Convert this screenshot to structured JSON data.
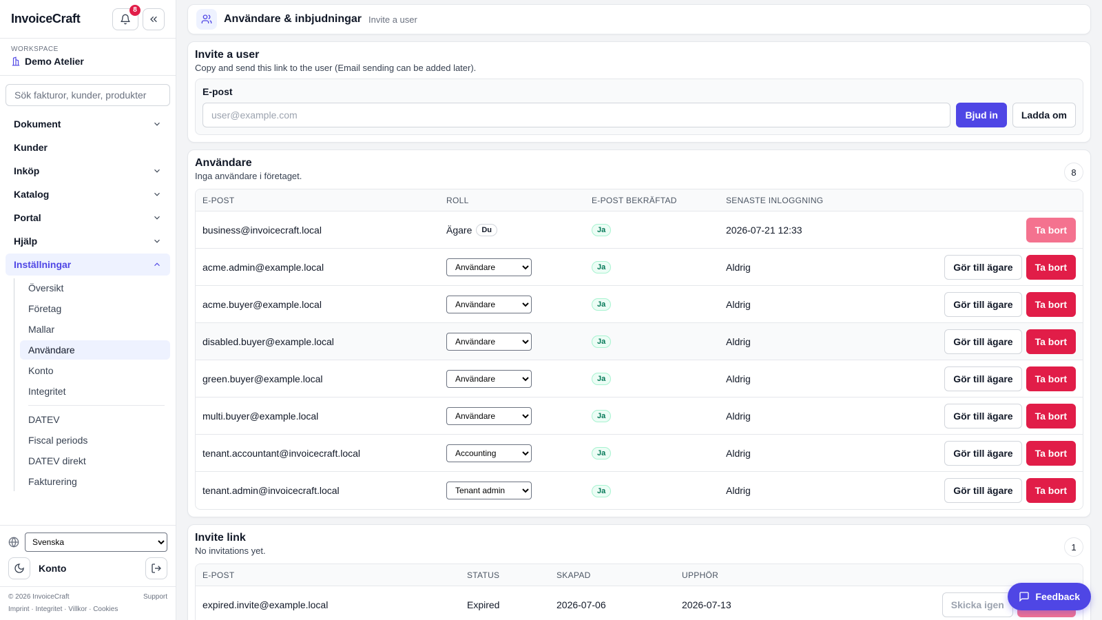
{
  "app": {
    "brand": "InvoiceCraft",
    "notification_count": "8"
  },
  "workspace": {
    "label": "WORKSPACE",
    "name": "Demo Atelier"
  },
  "search": {
    "placeholder": "Sök fakturor, kunder, produkter"
  },
  "nav": {
    "items": [
      {
        "label": "Dokument",
        "has_chevron": true
      },
      {
        "label": "Kunder",
        "has_chevron": false
      },
      {
        "label": "Inköp",
        "has_chevron": true
      },
      {
        "label": "Katalog",
        "has_chevron": true
      },
      {
        "label": "Portal",
        "has_chevron": true
      },
      {
        "label": "Hjälp",
        "has_chevron": true
      },
      {
        "label": "Inställningar",
        "has_chevron": true,
        "expanded": true
      }
    ],
    "sub_items": [
      "Översikt",
      "Företag",
      "Mallar",
      "Användare",
      "Konto",
      "Integritet"
    ],
    "sub_items_2": [
      "DATEV",
      "Fiscal periods",
      "DATEV direkt",
      "Fakturering"
    ],
    "active_sub": "Användare"
  },
  "sidebar_bottom": {
    "language": "Svenska",
    "konto_label": "Konto",
    "copyright": "© 2026 InvoiceCraft",
    "support": "Support",
    "links": [
      "Imprint",
      "Integritet",
      "Villkor",
      "Cookies"
    ]
  },
  "topbar": {
    "title": "Användare & inbjudningar",
    "subtitle": "Invite a user"
  },
  "invite": {
    "title": "Invite a user",
    "description": "Copy and send this link to the user (Email sending can be added later).",
    "email_label": "E-post",
    "email_placeholder": "user@example.com",
    "invite_button": "Bjud in",
    "reload_button": "Ladda om"
  },
  "users": {
    "title": "Användare",
    "description": "Inga användare i företaget.",
    "count": "8",
    "columns": [
      "E-POST",
      "ROLL",
      "E-POST BEKRÄFTAD",
      "SENASTE INLOGGNING"
    ],
    "make_owner_label": "Gör till ägare",
    "remove_label": "Ta bort",
    "owner_role_label": "Ägare",
    "you_badge": "Du",
    "rows": [
      {
        "email": "business@invoicecraft.local",
        "role": "Ägare",
        "owner": true,
        "confirmed": "Ja",
        "last_login": "2026-07-21 12:33"
      },
      {
        "email": "acme.admin@example.local",
        "role": "Användare",
        "owner": false,
        "confirmed": "Ja",
        "last_login": "Aldrig"
      },
      {
        "email": "acme.buyer@example.local",
        "role": "Användare",
        "owner": false,
        "confirmed": "Ja",
        "last_login": "Aldrig"
      },
      {
        "email": "disabled.buyer@example.local",
        "role": "Användare",
        "owner": false,
        "confirmed": "Ja",
        "last_login": "Aldrig"
      },
      {
        "email": "green.buyer@example.local",
        "role": "Användare",
        "owner": false,
        "confirmed": "Ja",
        "last_login": "Aldrig"
      },
      {
        "email": "multi.buyer@example.local",
        "role": "Användare",
        "owner": false,
        "confirmed": "Ja",
        "last_login": "Aldrig"
      },
      {
        "email": "tenant.accountant@invoicecraft.local",
        "role": "Accounting",
        "owner": false,
        "confirmed": "Ja",
        "last_login": "Aldrig"
      },
      {
        "email": "tenant.admin@invoicecraft.local",
        "role": "Tenant admin",
        "owner": false,
        "confirmed": "Ja",
        "last_login": "Aldrig"
      }
    ]
  },
  "invite_link": {
    "title": "Invite link",
    "description": "No invitations yet.",
    "count": "1",
    "columns": [
      "E-POST",
      "STATUS",
      "SKAPAD",
      "UPPHÖR"
    ],
    "rows": [
      {
        "email": "expired.invite@example.local",
        "status": "Expired",
        "created": "2026-07-06",
        "expires": "2026-07-13",
        "resend_label": "Skicka igen",
        "revoke_label": "Återkalla"
      }
    ]
  },
  "feedback": {
    "label": "Feedback"
  },
  "colors": {
    "accent": "#4f46e5",
    "danger": "#e11d48",
    "success": "#047857"
  }
}
